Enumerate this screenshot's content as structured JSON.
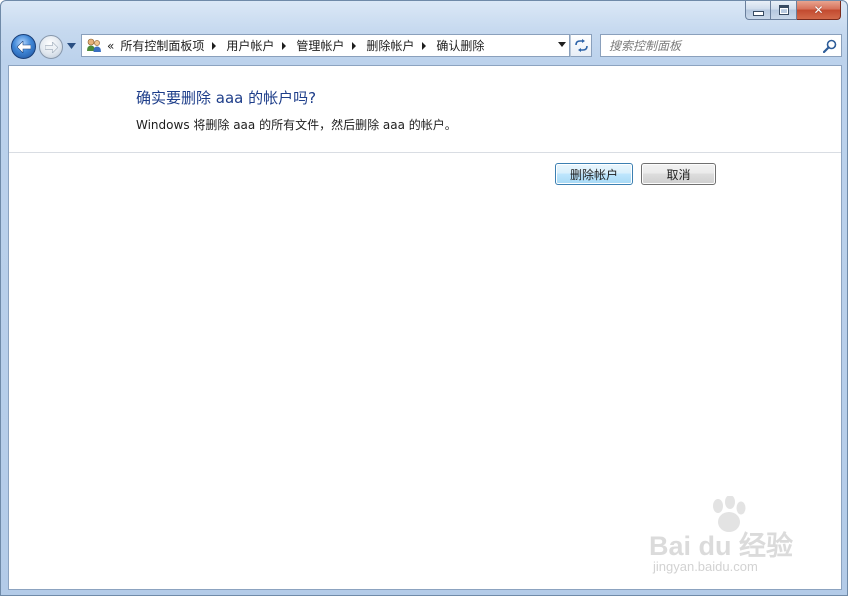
{
  "window": {
    "caption": {
      "minimize_icon": "minimize-icon",
      "maximize_icon": "maximize-icon",
      "close_icon": "close-icon"
    }
  },
  "navigation": {
    "back_icon": "back-arrow-icon",
    "forward_icon": "forward-arrow-icon",
    "recent_pages_icon": "chevron-down-icon",
    "breadcrumb_overflow": "«",
    "breadcrumbs": [
      {
        "label": "所有控制面板项"
      },
      {
        "label": "用户帐户"
      },
      {
        "label": "管理帐户"
      },
      {
        "label": "删除帐户"
      },
      {
        "label": "确认删除"
      }
    ],
    "refresh_icon": "refresh-icon"
  },
  "search": {
    "placeholder": "搜索控制面板",
    "value": ""
  },
  "content": {
    "title": "确实要删除 aaa 的帐户吗?",
    "description": "Windows 将删除 aaa 的所有文件，然后删除 aaa 的帐户。",
    "buttons": {
      "delete_label": "删除帐户",
      "cancel_label": "取消"
    }
  },
  "watermark": {
    "brand": "Bai du 经验",
    "url": "jingyan.baidu.com"
  },
  "colors": {
    "title_text": "#1e3e8a",
    "window_frame": "#c6d9ef",
    "close_button": "#c24a2f",
    "default_button_border": "#3c7fb1"
  }
}
